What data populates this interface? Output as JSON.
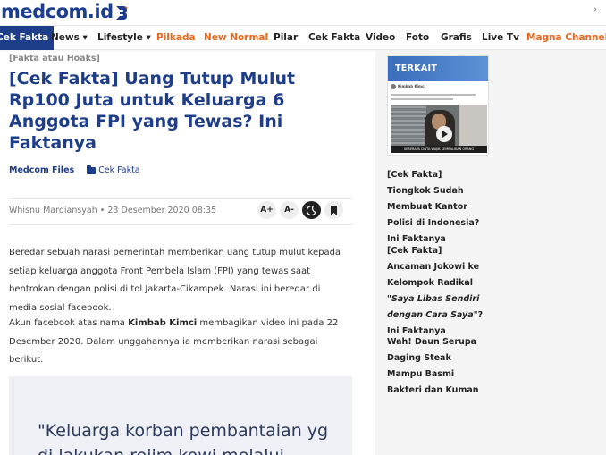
{
  "header": {
    "logo_text": "medcom.id",
    "logo_mark_color": "#1d3e8f"
  },
  "nav": {
    "items": [
      {
        "label": "Cek Fakta",
        "active": true
      },
      {
        "label": "News ▾"
      },
      {
        "label": "Lifestyle ▾"
      },
      {
        "label": "Pilkada",
        "color": "#e8651b"
      },
      {
        "label": "New Normal",
        "color": "#e8651b"
      },
      {
        "label": "Pilar"
      },
      {
        "label": "Cek Fakta"
      },
      {
        "label": "Video"
      },
      {
        "label": "Foto"
      },
      {
        "label": "Grafis"
      },
      {
        "label": "Live Tv"
      },
      {
        "label": "Magna Channel",
        "color": "#e8651b"
      }
    ]
  },
  "article": {
    "category": "[Fakta atau Hoaks]",
    "title": "[Cek Fakta] Uang Tutup Mulut Rp100 Juta untuk Keluarga 6 Anggota FPI yang Tewas? Ini Faktanya",
    "source": "Medcom Files",
    "section": "Cek Fakta",
    "byline": "Whisnu Mardiansyah • 23 Desember 2020 08:35",
    "tools": {
      "font_up": "A+",
      "font_down": "A-"
    },
    "paragraph1": "Beredar sebuah narasi pemerintah memberikan uang tutup mulut kepada setiap keluarga anggota Front Pembela Islam (FPI) yang tewas saat bentrokan dengan polisi di tol Jakarta-Cikampek. Narasi ini beredar di media sosial facebook.",
    "paragraph2_before": "Akun facebook atas nama ",
    "paragraph2_bold": "Kimbab Kimci",
    "paragraph2_after": " membagikan video ini pada 22 Desember 2020. Dalam unggahannya ia memberikan narasi sebagai berikut.",
    "quote_line1": "\"Keluarga korban pembantaian yg",
    "quote_line2": "di lakukan rejim kowi melalui"
  },
  "sidebar": {
    "related_badge": "TERKAIT",
    "thumb_post_name": "Kimbab Kimci",
    "thumb_caption": "SEBERAPA CINTA WAJIB KEMBALIKAN ORANG",
    "links": [
      {
        "text": "[Cek Fakta] Tiongkok Sudah Membuat Kantor Polisi di Indonesia? Ini Faktanya"
      },
      {
        "before": "[Cek Fakta] Ancaman Jokowi ke Kelompok Radikal ",
        "italic": "\"Saya Libas Sendiri dengan Cara Saya\"",
        "after": "? Ini Faktanya"
      },
      {
        "text": "Wah! Daun Serupa Daging Steak Mampu Basmi Bakteri dan Kuman"
      }
    ]
  },
  "colors": {
    "brand": "#1f3e8a",
    "accent": "#e8651b",
    "sidebar_bg": "#f4f4f4"
  }
}
